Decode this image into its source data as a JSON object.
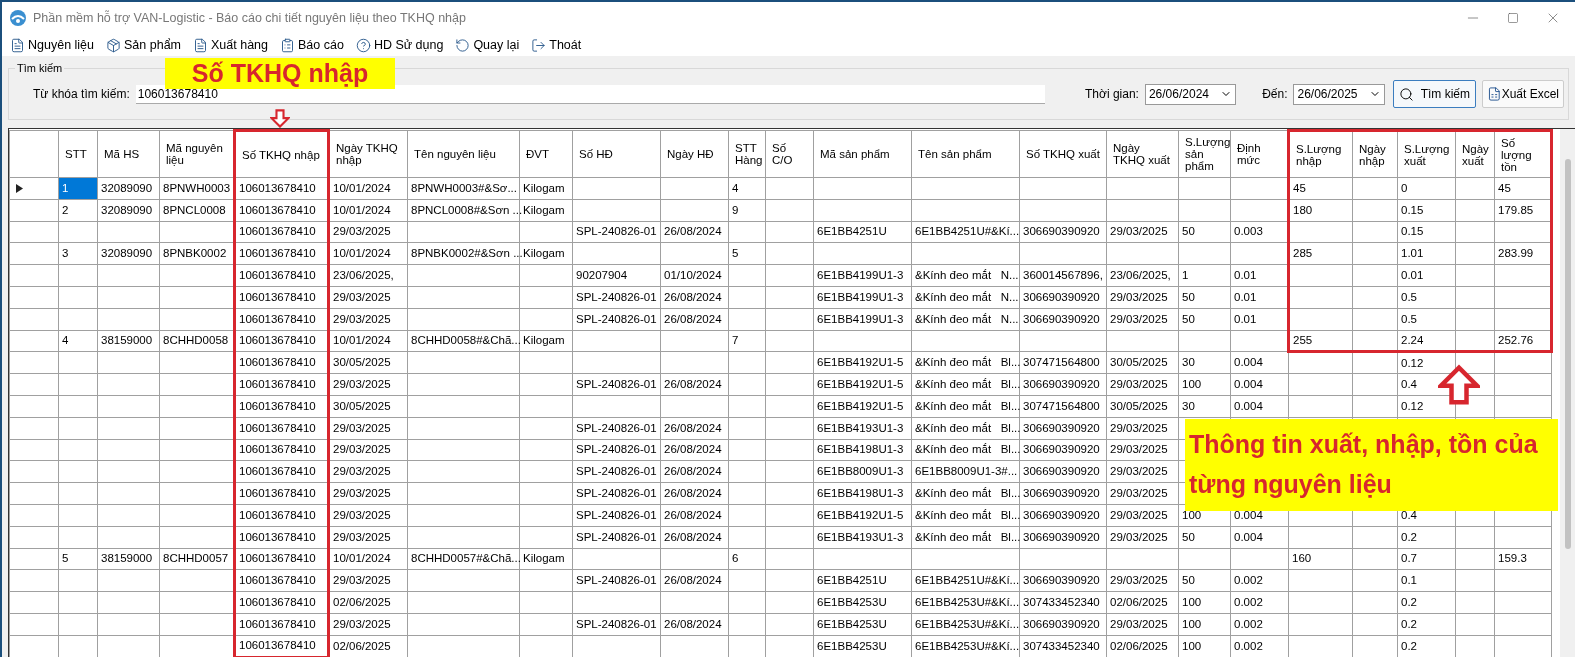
{
  "window": {
    "title": "Phần mềm hỗ trợ VAN-Logistic - Báo cáo chi tiết nguyên liệu theo TKHQ nhập"
  },
  "menu": [
    {
      "label": "Nguyên liệu",
      "kind": "doc"
    },
    {
      "label": "Sản phẩm",
      "kind": "product"
    },
    {
      "label": "Xuất hàng",
      "kind": "doc"
    },
    {
      "label": "Báo cáo",
      "kind": "report"
    },
    {
      "label": "HD Sử dụng",
      "kind": "help"
    },
    {
      "label": "Quay lại",
      "kind": "back"
    },
    {
      "label": "Thoát",
      "kind": "exit"
    }
  ],
  "search": {
    "group": "Tìm kiếm",
    "keyword_label": "Từ khóa tìm kiếm:",
    "keyword": "106013678410",
    "from_label": "Thời gian:",
    "from": "26/06/2024",
    "to_label": "Đến:",
    "to": "26/06/2025",
    "search_button": "Tìm kiếm",
    "export_button": "Xuất Excel"
  },
  "table": {
    "columns": [
      "STT",
      "Mã HS",
      "Mã nguyên liệu",
      "Số TKHQ nhập",
      "Ngày TKHQ nhập",
      "Tên nguyên liệu",
      "ĐVT",
      "Số HĐ",
      "Ngày HĐ",
      "STT Hàng",
      "Số C/O",
      "Mã sản phẩm",
      "Tên sản phẩm",
      "Số TKHQ xuất",
      "Ngày TKHQ xuất",
      "S.Lượng sản phẩm",
      "Định mức",
      "S.Lượng nhập",
      "Ngày nhập",
      "S.Lượng xuất",
      "Ngày xuất",
      "Số lượng tồn"
    ],
    "rows": [
      {
        "selected": true,
        "cells": [
          "1",
          "32089090",
          "8PNWH0003",
          "106013678410",
          "10/01/2024",
          "8PNWH0003#&Sơ...",
          "Kilogam",
          null,
          null,
          "4",
          null,
          null,
          null,
          null,
          null,
          null,
          null,
          "45",
          null,
          "0",
          null,
          "45"
        ]
      },
      {
        "selected": false,
        "cells": [
          "2",
          "32089090",
          "8PNCL0008",
          "106013678410",
          "10/01/2024",
          "8PNCL0008#&Sơn ...",
          "Kilogam",
          null,
          null,
          "9",
          null,
          null,
          null,
          null,
          null,
          null,
          null,
          "180",
          null,
          "0.15",
          null,
          "179.85"
        ]
      },
      {
        "selected": false,
        "cells": [
          null,
          null,
          null,
          "106013678410",
          "29/03/2025",
          null,
          null,
          "SPL-240826-01",
          "26/08/2024",
          null,
          null,
          "6E1BB4251U",
          "6E1BB4251U#&Kí...",
          "306690390920",
          "29/03/2025",
          "50",
          "0.003",
          null,
          null,
          "0.15",
          null,
          null
        ]
      },
      {
        "selected": false,
        "cells": [
          "3",
          "32089090",
          "8PNBK0002",
          "106013678410",
          "10/01/2024",
          "8PNBK0002#&Sơn ...",
          "Kilogam",
          null,
          null,
          "5",
          null,
          null,
          null,
          null,
          null,
          null,
          null,
          "285",
          null,
          "1.01",
          null,
          "283.99"
        ]
      },
      {
        "selected": false,
        "cells": [
          null,
          null,
          null,
          "106013678410",
          "23/06/2025,",
          null,
          null,
          "90207904",
          "01/10/2024",
          null,
          null,
          "6E1BB4199U1-3",
          "&Kính đeo mắt   N...",
          "360014567896,",
          "23/06/2025,",
          "1",
          "0.01",
          null,
          null,
          "0.01",
          null,
          null
        ]
      },
      {
        "selected": false,
        "cells": [
          null,
          null,
          null,
          "106013678410",
          "29/03/2025",
          null,
          null,
          "SPL-240826-01",
          "26/08/2024",
          null,
          null,
          "6E1BB4199U1-3",
          "&Kính đeo mắt   N...",
          "306690390920",
          "29/03/2025",
          "50",
          "0.01",
          null,
          null,
          "0.5",
          null,
          null
        ]
      },
      {
        "selected": false,
        "cells": [
          null,
          null,
          null,
          "106013678410",
          "29/03/2025",
          null,
          null,
          "SPL-240826-01",
          "26/08/2024",
          null,
          null,
          "6E1BB4199U1-3",
          "&Kính đeo mắt   N...",
          "306690390920",
          "29/03/2025",
          "50",
          "0.01",
          null,
          null,
          "0.5",
          null,
          null
        ]
      },
      {
        "selected": false,
        "cells": [
          "4",
          "38159000",
          "8CHHD0058",
          "106013678410",
          "10/01/2024",
          "8CHHD0058#&Chã...",
          "Kilogam",
          null,
          null,
          "7",
          null,
          null,
          null,
          null,
          null,
          null,
          null,
          "255",
          null,
          "2.24",
          null,
          "252.76"
        ]
      },
      {
        "selected": false,
        "cells": [
          null,
          null,
          null,
          "106013678410",
          "30/05/2025",
          null,
          null,
          null,
          null,
          null,
          null,
          "6E1BB4192U1-5",
          "&Kính đeo mắt   Bl...",
          "307471564800",
          "30/05/2025",
          "30",
          "0.004",
          null,
          null,
          "0.12",
          null,
          null
        ]
      },
      {
        "selected": false,
        "cells": [
          null,
          null,
          null,
          "106013678410",
          "29/03/2025",
          null,
          null,
          "SPL-240826-01",
          "26/08/2024",
          null,
          null,
          "6E1BB4192U1-5",
          "&Kính đeo mắt   Bl...",
          "306690390920",
          "29/03/2025",
          "100",
          "0.004",
          null,
          null,
          "0.4",
          null,
          null
        ]
      },
      {
        "selected": false,
        "cells": [
          null,
          null,
          null,
          "106013678410",
          "30/05/2025",
          null,
          null,
          null,
          null,
          null,
          null,
          "6E1BB4192U1-5",
          "&Kính đeo mắt   Bl...",
          "307471564800",
          "30/05/2025",
          "30",
          "0.004",
          null,
          null,
          "0.12",
          null,
          null
        ]
      },
      {
        "selected": false,
        "cells": [
          null,
          null,
          null,
          "106013678410",
          "29/03/2025",
          null,
          null,
          "SPL-240826-01",
          "26/08/2024",
          null,
          null,
          "6E1BB4193U1-3",
          "&Kính đeo mắt   Bl...",
          "306690390920",
          "29/03/2025",
          null,
          null,
          null,
          null,
          null,
          null,
          null
        ]
      },
      {
        "selected": false,
        "cells": [
          null,
          null,
          null,
          "106013678410",
          "29/03/2025",
          null,
          null,
          "SPL-240826-01",
          "26/08/2024",
          null,
          null,
          "6E1BB4198U1-3",
          "&Kính đeo mắt   Bl...",
          "306690390920",
          "29/03/2025",
          null,
          null,
          null,
          null,
          null,
          null,
          null
        ]
      },
      {
        "selected": false,
        "cells": [
          null,
          null,
          null,
          "106013678410",
          "29/03/2025",
          null,
          null,
          "SPL-240826-01",
          "26/08/2024",
          null,
          null,
          "6E1BB8009U1-3",
          "6E1BB8009U1-3#...",
          "306690390920",
          "29/03/2025",
          null,
          null,
          null,
          null,
          null,
          null,
          null
        ]
      },
      {
        "selected": false,
        "cells": [
          null,
          null,
          null,
          "106013678410",
          "29/03/2025",
          null,
          null,
          "SPL-240826-01",
          "26/08/2024",
          null,
          null,
          "6E1BB4198U1-3",
          "&Kính đeo mắt   Bl...",
          "306690390920",
          "29/03/2025",
          null,
          null,
          null,
          null,
          null,
          null,
          null
        ]
      },
      {
        "selected": false,
        "cells": [
          null,
          null,
          null,
          "106013678410",
          "29/03/2025",
          null,
          null,
          "SPL-240826-01",
          "26/08/2024",
          null,
          null,
          "6E1BB4192U1-5",
          "&Kính đeo mắt   Bl...",
          "306690390920",
          "29/03/2025",
          "100",
          "0.004",
          null,
          null,
          "0.4",
          null,
          null
        ]
      },
      {
        "selected": false,
        "cells": [
          null,
          null,
          null,
          "106013678410",
          "29/03/2025",
          null,
          null,
          "SPL-240826-01",
          "26/08/2024",
          null,
          null,
          "6E1BB4193U1-3",
          "&Kính đeo mắt   Bl...",
          "306690390920",
          "29/03/2025",
          "50",
          "0.004",
          null,
          null,
          "0.2",
          null,
          null
        ]
      },
      {
        "selected": false,
        "cells": [
          "5",
          "38159000",
          "8CHHD0057",
          "106013678410",
          "10/01/2024",
          "8CHHD0057#&Chã...",
          "Kilogam",
          null,
          null,
          "6",
          null,
          null,
          null,
          null,
          null,
          null,
          null,
          "160",
          null,
          "0.7",
          null,
          "159.3"
        ]
      },
      {
        "selected": false,
        "cells": [
          null,
          null,
          null,
          "106013678410",
          "29/03/2025",
          null,
          null,
          "SPL-240826-01",
          "26/08/2024",
          null,
          null,
          "6E1BB4251U",
          "6E1BB4251U#&Kí...",
          "306690390920",
          "29/03/2025",
          "50",
          "0.002",
          null,
          null,
          "0.1",
          null,
          null
        ]
      },
      {
        "selected": false,
        "cells": [
          null,
          null,
          null,
          "106013678410",
          "02/06/2025",
          null,
          null,
          null,
          null,
          null,
          null,
          "6E1BB4253U",
          "6E1BB4253U#&Kí...",
          "307433452340",
          "02/06/2025",
          "100",
          "0.002",
          null,
          null,
          "0.2",
          null,
          null
        ]
      },
      {
        "selected": false,
        "cells": [
          null,
          null,
          null,
          "106013678410",
          "29/03/2025",
          null,
          null,
          "SPL-240826-01",
          "26/08/2024",
          null,
          null,
          "6E1BB4253U",
          "6E1BB4253U#&Kí...",
          "306690390920",
          "29/03/2025",
          "100",
          "0.002",
          null,
          null,
          "0.2",
          null,
          null
        ]
      },
      {
        "selected": false,
        "cells": [
          null,
          null,
          null,
          "106013678410",
          "02/06/2025",
          null,
          null,
          null,
          null,
          null,
          null,
          "6E1BB4253U",
          "6E1BB4253U#&Kí...",
          "307433452340",
          "02/06/2025",
          "100",
          "0.002",
          null,
          null,
          "0.2",
          null,
          null
        ]
      }
    ]
  },
  "annotations": [
    {
      "kind": "top",
      "text": "Số TKHQ nhập"
    },
    {
      "kind": "side",
      "text": "Thông tin xuất, nhập, tồn của từng nguyên liệu"
    }
  ]
}
